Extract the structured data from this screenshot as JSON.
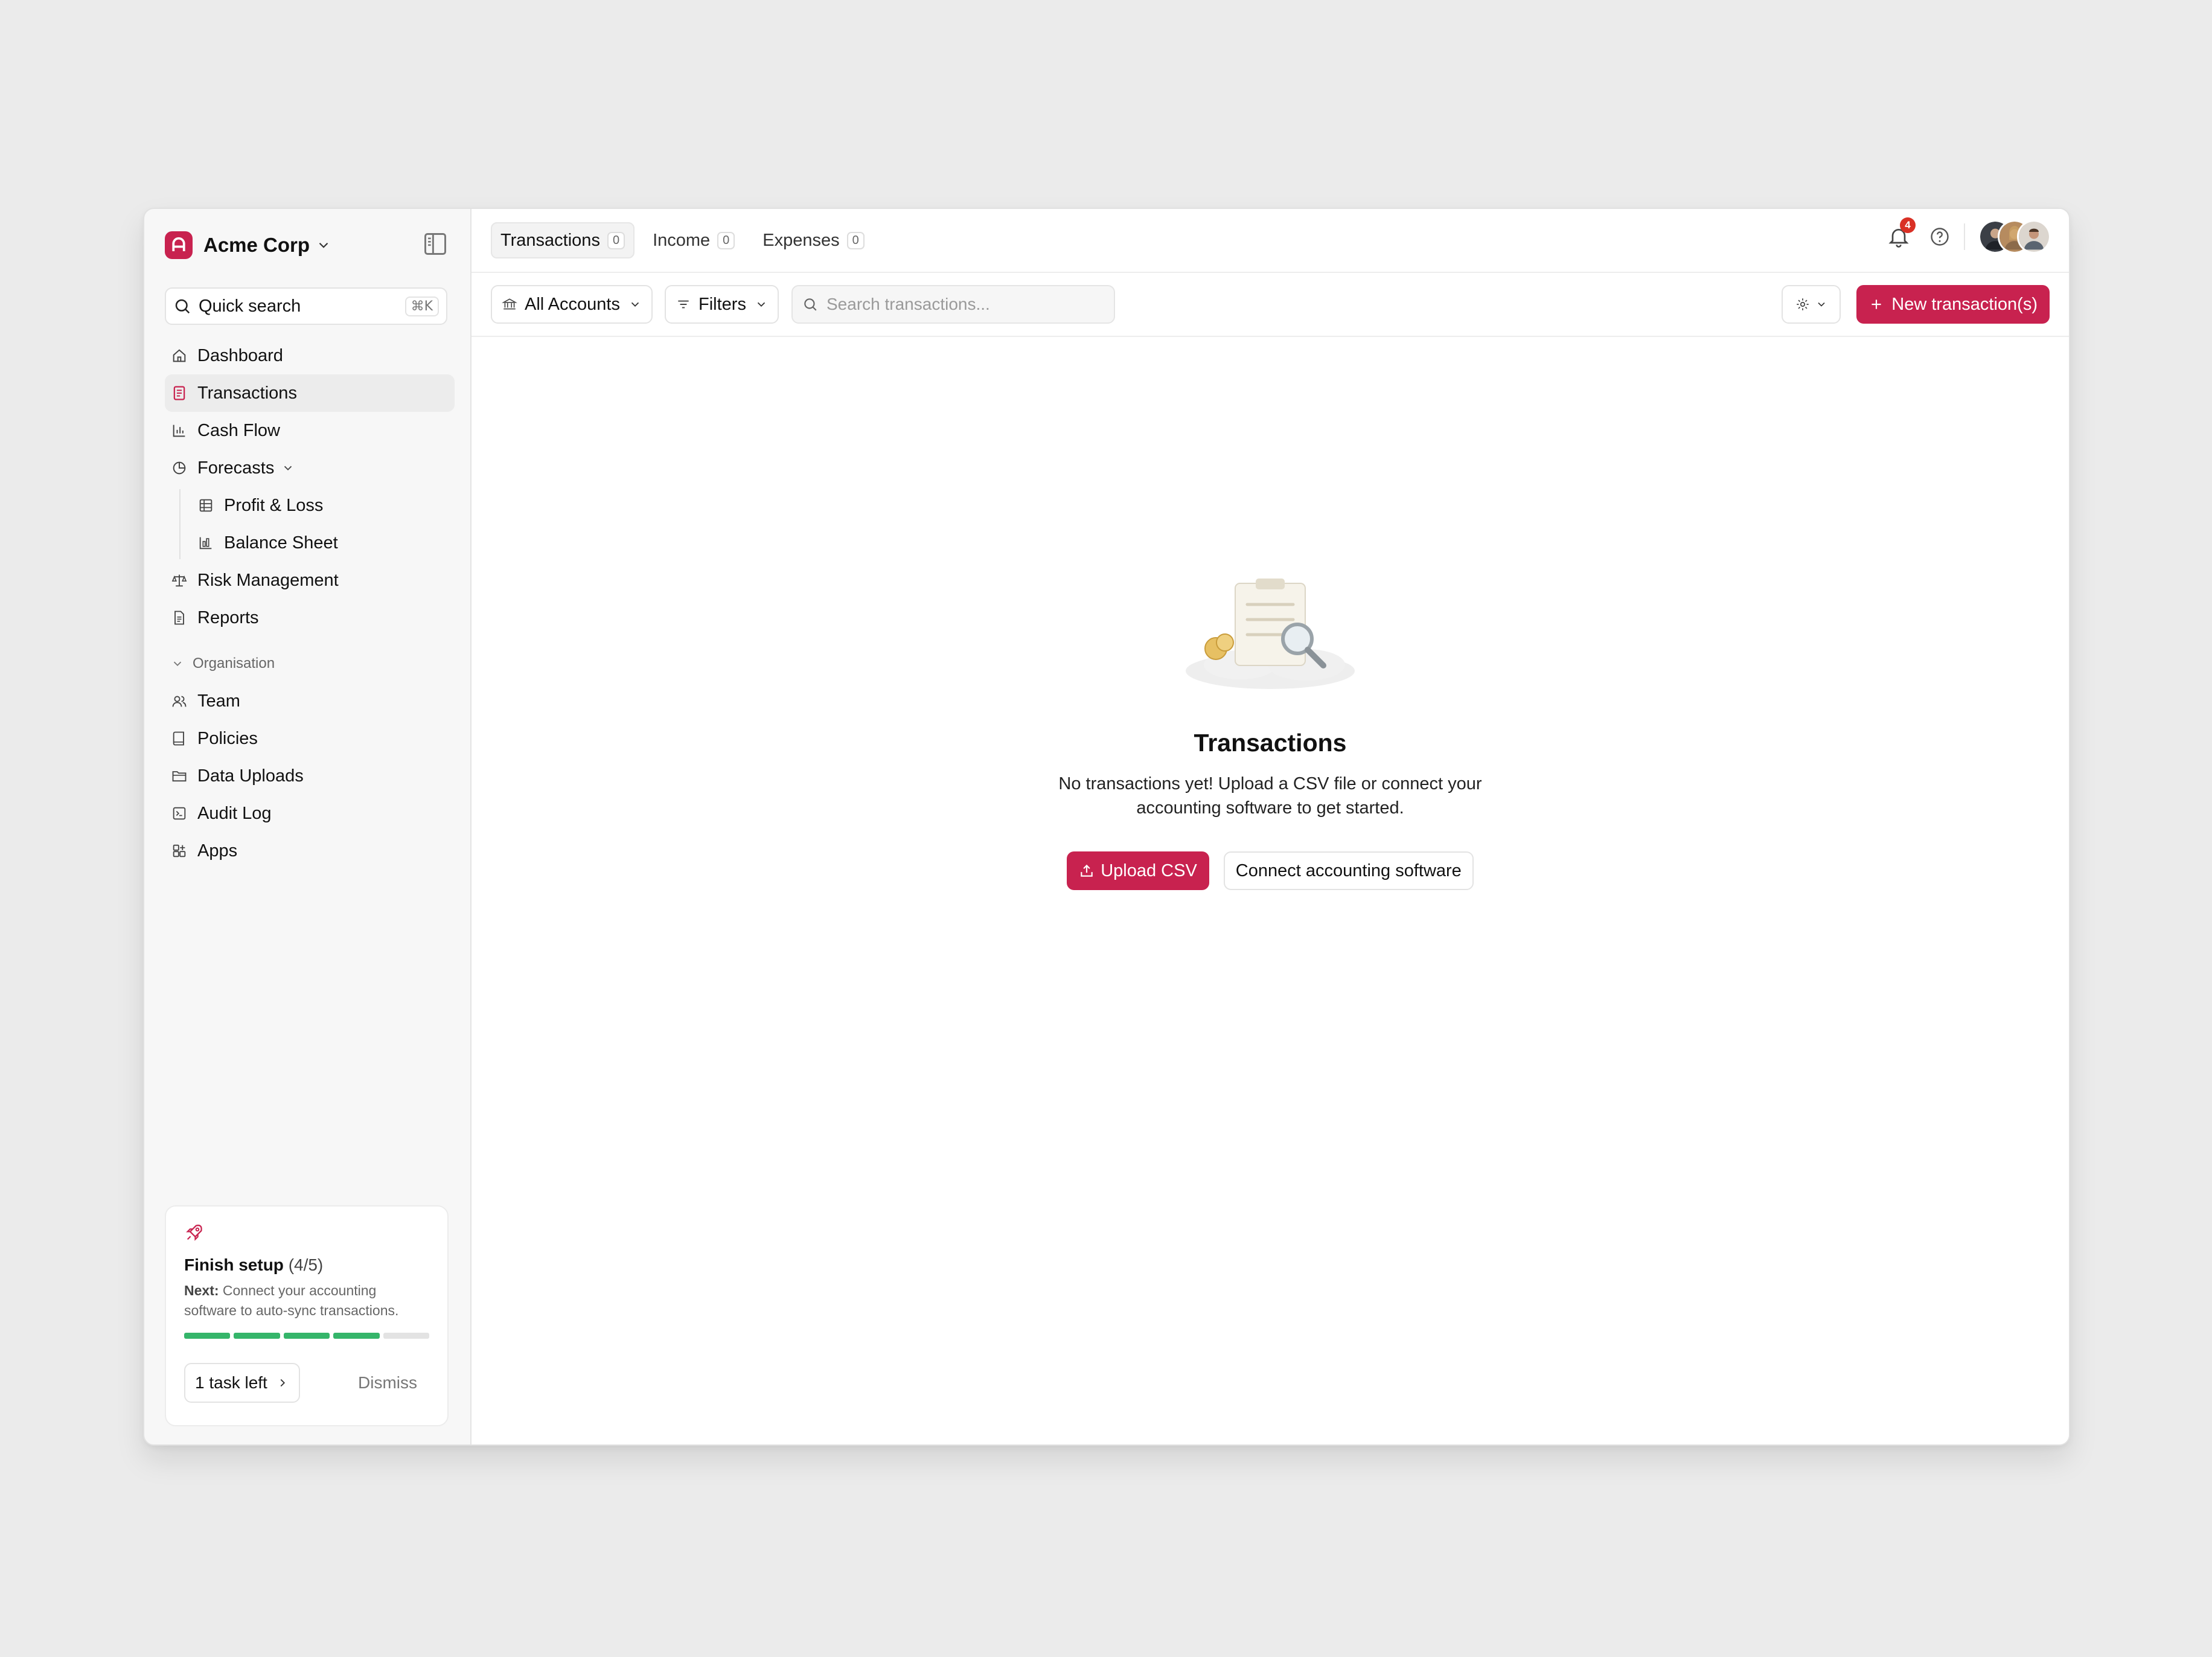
{
  "brand": {
    "name": "Acme Corp",
    "logo_letter": "A",
    "accent": "#c8224f"
  },
  "quick_search": {
    "label": "Quick search",
    "shortcut": "⌘K"
  },
  "nav": {
    "items": [
      {
        "label": "Dashboard",
        "icon": "home-icon"
      },
      {
        "label": "Transactions",
        "icon": "receipt-icon",
        "active": true
      },
      {
        "label": "Cash Flow",
        "icon": "bar-chart-icon"
      },
      {
        "label": "Forecasts",
        "icon": "pie-chart-icon",
        "expanded": true
      },
      {
        "label": "Profit & Loss",
        "icon": "table-icon"
      },
      {
        "label": "Balance Sheet",
        "icon": "bar-chart-box-icon"
      },
      {
        "label": "Risk Management",
        "icon": "scale-icon"
      },
      {
        "label": "Reports",
        "icon": "document-icon"
      }
    ],
    "org_title": "Organisation",
    "org_items": [
      {
        "label": "Team",
        "icon": "users-icon"
      },
      {
        "label": "Policies",
        "icon": "book-icon"
      },
      {
        "label": "Data Uploads",
        "icon": "folder-icon"
      },
      {
        "label": "Audit Log",
        "icon": "log-icon"
      },
      {
        "label": "Apps",
        "icon": "grid-plus-icon"
      }
    ]
  },
  "setup": {
    "title": "Finish setup",
    "count": "(4/5)",
    "next_label": "Next:",
    "next_text": "Connect your accounting software to auto-sync transactions.",
    "steps_done": 4,
    "steps_total": 5,
    "task_button": "1 task left",
    "dismiss": "Dismiss",
    "progress_color": "#35b56a"
  },
  "tabs": [
    {
      "label": "Transactions",
      "count": "0",
      "active": true
    },
    {
      "label": "Income",
      "count": "0"
    },
    {
      "label": "Expenses",
      "count": "0"
    }
  ],
  "notifications": {
    "count": "4"
  },
  "toolbar": {
    "accounts": "All Accounts",
    "filters": "Filters",
    "search_placeholder": "Search transactions...",
    "new_button": "New transaction(s)"
  },
  "empty_state": {
    "title": "Transactions",
    "description_line1": "No transactions yet! Upload a CSV file or connect your",
    "description_line2": "accounting software to get started.",
    "upload_button": "Upload CSV",
    "connect_button": "Connect accounting software"
  }
}
